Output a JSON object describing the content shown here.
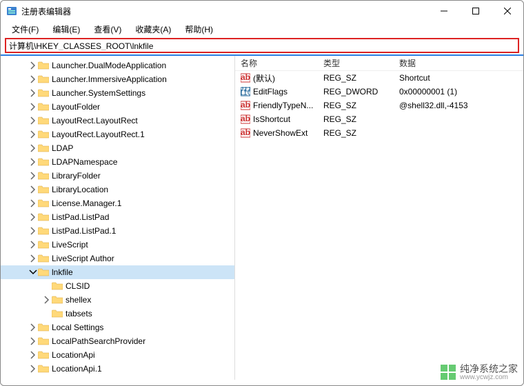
{
  "window": {
    "title": "注册表编辑器"
  },
  "menu": {
    "file": "文件(F)",
    "edit": "编辑(E)",
    "view": "查看(V)",
    "favorites": "收藏夹(A)",
    "help": "帮助(H)"
  },
  "address": {
    "path": "计算机\\HKEY_CLASSES_ROOT\\lnkfile"
  },
  "tree": [
    {
      "indent": 40,
      "expand": "right",
      "label": "Launcher.DualModeApplication"
    },
    {
      "indent": 40,
      "expand": "right",
      "label": "Launcher.ImmersiveApplication"
    },
    {
      "indent": 40,
      "expand": "right",
      "label": "Launcher.SystemSettings"
    },
    {
      "indent": 40,
      "expand": "right",
      "label": "LayoutFolder"
    },
    {
      "indent": 40,
      "expand": "right",
      "label": "LayoutRect.LayoutRect"
    },
    {
      "indent": 40,
      "expand": "right",
      "label": "LayoutRect.LayoutRect.1"
    },
    {
      "indent": 40,
      "expand": "right",
      "label": "LDAP"
    },
    {
      "indent": 40,
      "expand": "right",
      "label": "LDAPNamespace"
    },
    {
      "indent": 40,
      "expand": "right",
      "label": "LibraryFolder"
    },
    {
      "indent": 40,
      "expand": "right",
      "label": "LibraryLocation"
    },
    {
      "indent": 40,
      "expand": "right",
      "label": "License.Manager.1"
    },
    {
      "indent": 40,
      "expand": "right",
      "label": "ListPad.ListPad"
    },
    {
      "indent": 40,
      "expand": "right",
      "label": "ListPad.ListPad.1"
    },
    {
      "indent": 40,
      "expand": "right",
      "label": "LiveScript"
    },
    {
      "indent": 40,
      "expand": "right",
      "label": "LiveScript Author"
    },
    {
      "indent": 40,
      "expand": "down",
      "label": "lnkfile",
      "selected": true
    },
    {
      "indent": 60,
      "expand": "none",
      "label": "CLSID"
    },
    {
      "indent": 60,
      "expand": "right",
      "label": "shellex"
    },
    {
      "indent": 60,
      "expand": "none",
      "label": "tabsets"
    },
    {
      "indent": 40,
      "expand": "right",
      "label": "Local Settings"
    },
    {
      "indent": 40,
      "expand": "right",
      "label": "LocalPathSearchProvider"
    },
    {
      "indent": 40,
      "expand": "right",
      "label": "LocationApi"
    },
    {
      "indent": 40,
      "expand": "right",
      "label": "LocationApi.1"
    }
  ],
  "columns": {
    "name": "名称",
    "type": "类型",
    "data": "数据"
  },
  "values": [
    {
      "icon": "str",
      "name": "(默认)",
      "type": "REG_SZ",
      "data": "Shortcut"
    },
    {
      "icon": "bin",
      "name": "EditFlags",
      "type": "REG_DWORD",
      "data": "0x00000001 (1)"
    },
    {
      "icon": "str",
      "name": "FriendlyTypeN...",
      "type": "REG_SZ",
      "data": "@shell32.dll,-4153"
    },
    {
      "icon": "str",
      "name": "IsShortcut",
      "type": "REG_SZ",
      "data": ""
    },
    {
      "icon": "str",
      "name": "NeverShowExt",
      "type": "REG_SZ",
      "data": ""
    }
  ],
  "watermark": {
    "name": "纯净系统之家",
    "url": "www.ycwjz.com"
  }
}
